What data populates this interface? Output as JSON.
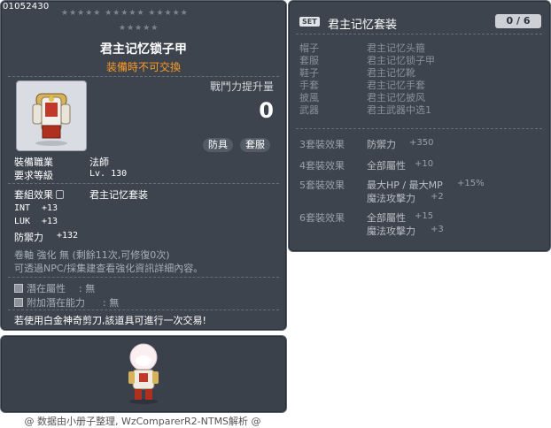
{
  "item": {
    "id": "01052430",
    "stars_row1": "★★★★★  ★★★★★  ★★★★★",
    "stars_row2": "★★★★★",
    "name": "君主记忆锁子甲",
    "trade_note": "装備時不可交換",
    "boost_label": "戰鬥力提升量",
    "boost_value": "0",
    "tag_armor": "防具",
    "tag_suit": "套服",
    "job_label": "裝備職業",
    "job_value": "法師",
    "level_label": "要求等級",
    "level_value": "Lv. 130",
    "set_effect_label": "套組效果",
    "set_effect_value": "君主记忆套装",
    "stats": [
      {
        "label": "INT",
        "value": "+13"
      },
      {
        "label": "LUK",
        "value": "+13"
      },
      {
        "label": "防禦力",
        "value": "+132"
      }
    ],
    "scroll_line": "卷軸 強化 無 (剩餘11次,可修復0次)",
    "npc_line": "可透過NPC/採集建查看強化資訊詳細內容。",
    "potential_label": "潛在屬性",
    "potential_value": ": 無",
    "add_potential_label": "附加潛在能力",
    "add_potential_value": ": 無",
    "scissors_line": "若使用白金神奇剪刀,該道具可進行一次交易!"
  },
  "set": {
    "badge": "SET",
    "title": "君主记忆套装",
    "count": "0 / 6",
    "pieces": [
      {
        "slot": "帽子",
        "name": "君主记忆头箍"
      },
      {
        "slot": "套服",
        "name": "君主记忆锁子甲"
      },
      {
        "slot": "鞋子",
        "name": "君主记忆靴"
      },
      {
        "slot": "手套",
        "name": "君主记忆手套"
      },
      {
        "slot": "披風",
        "name": "君主记忆披风"
      },
      {
        "slot": "武器",
        "name": "君主武器中选1"
      }
    ],
    "effects": [
      {
        "tier": "3套裝效果",
        "lines": [
          {
            "label": "防禦力",
            "value": "+350"
          }
        ]
      },
      {
        "tier": "4套裝效果",
        "lines": [
          {
            "label": "全部屬性",
            "value": "+10"
          }
        ]
      },
      {
        "tier": "5套裝效果",
        "lines": [
          {
            "label": "最大HP / 最大MP",
            "value": "+15%"
          },
          {
            "label": "魔法攻擊力",
            "value": "+2"
          }
        ]
      },
      {
        "tier": "6套裝效果",
        "lines": [
          {
            "label": "全部屬性",
            "value": "+15"
          },
          {
            "label": "魔法攻擊力",
            "value": "+3"
          }
        ]
      }
    ]
  },
  "credit": "@ 数据由小册子整理, WzComparerR2-NTMS解析 @"
}
